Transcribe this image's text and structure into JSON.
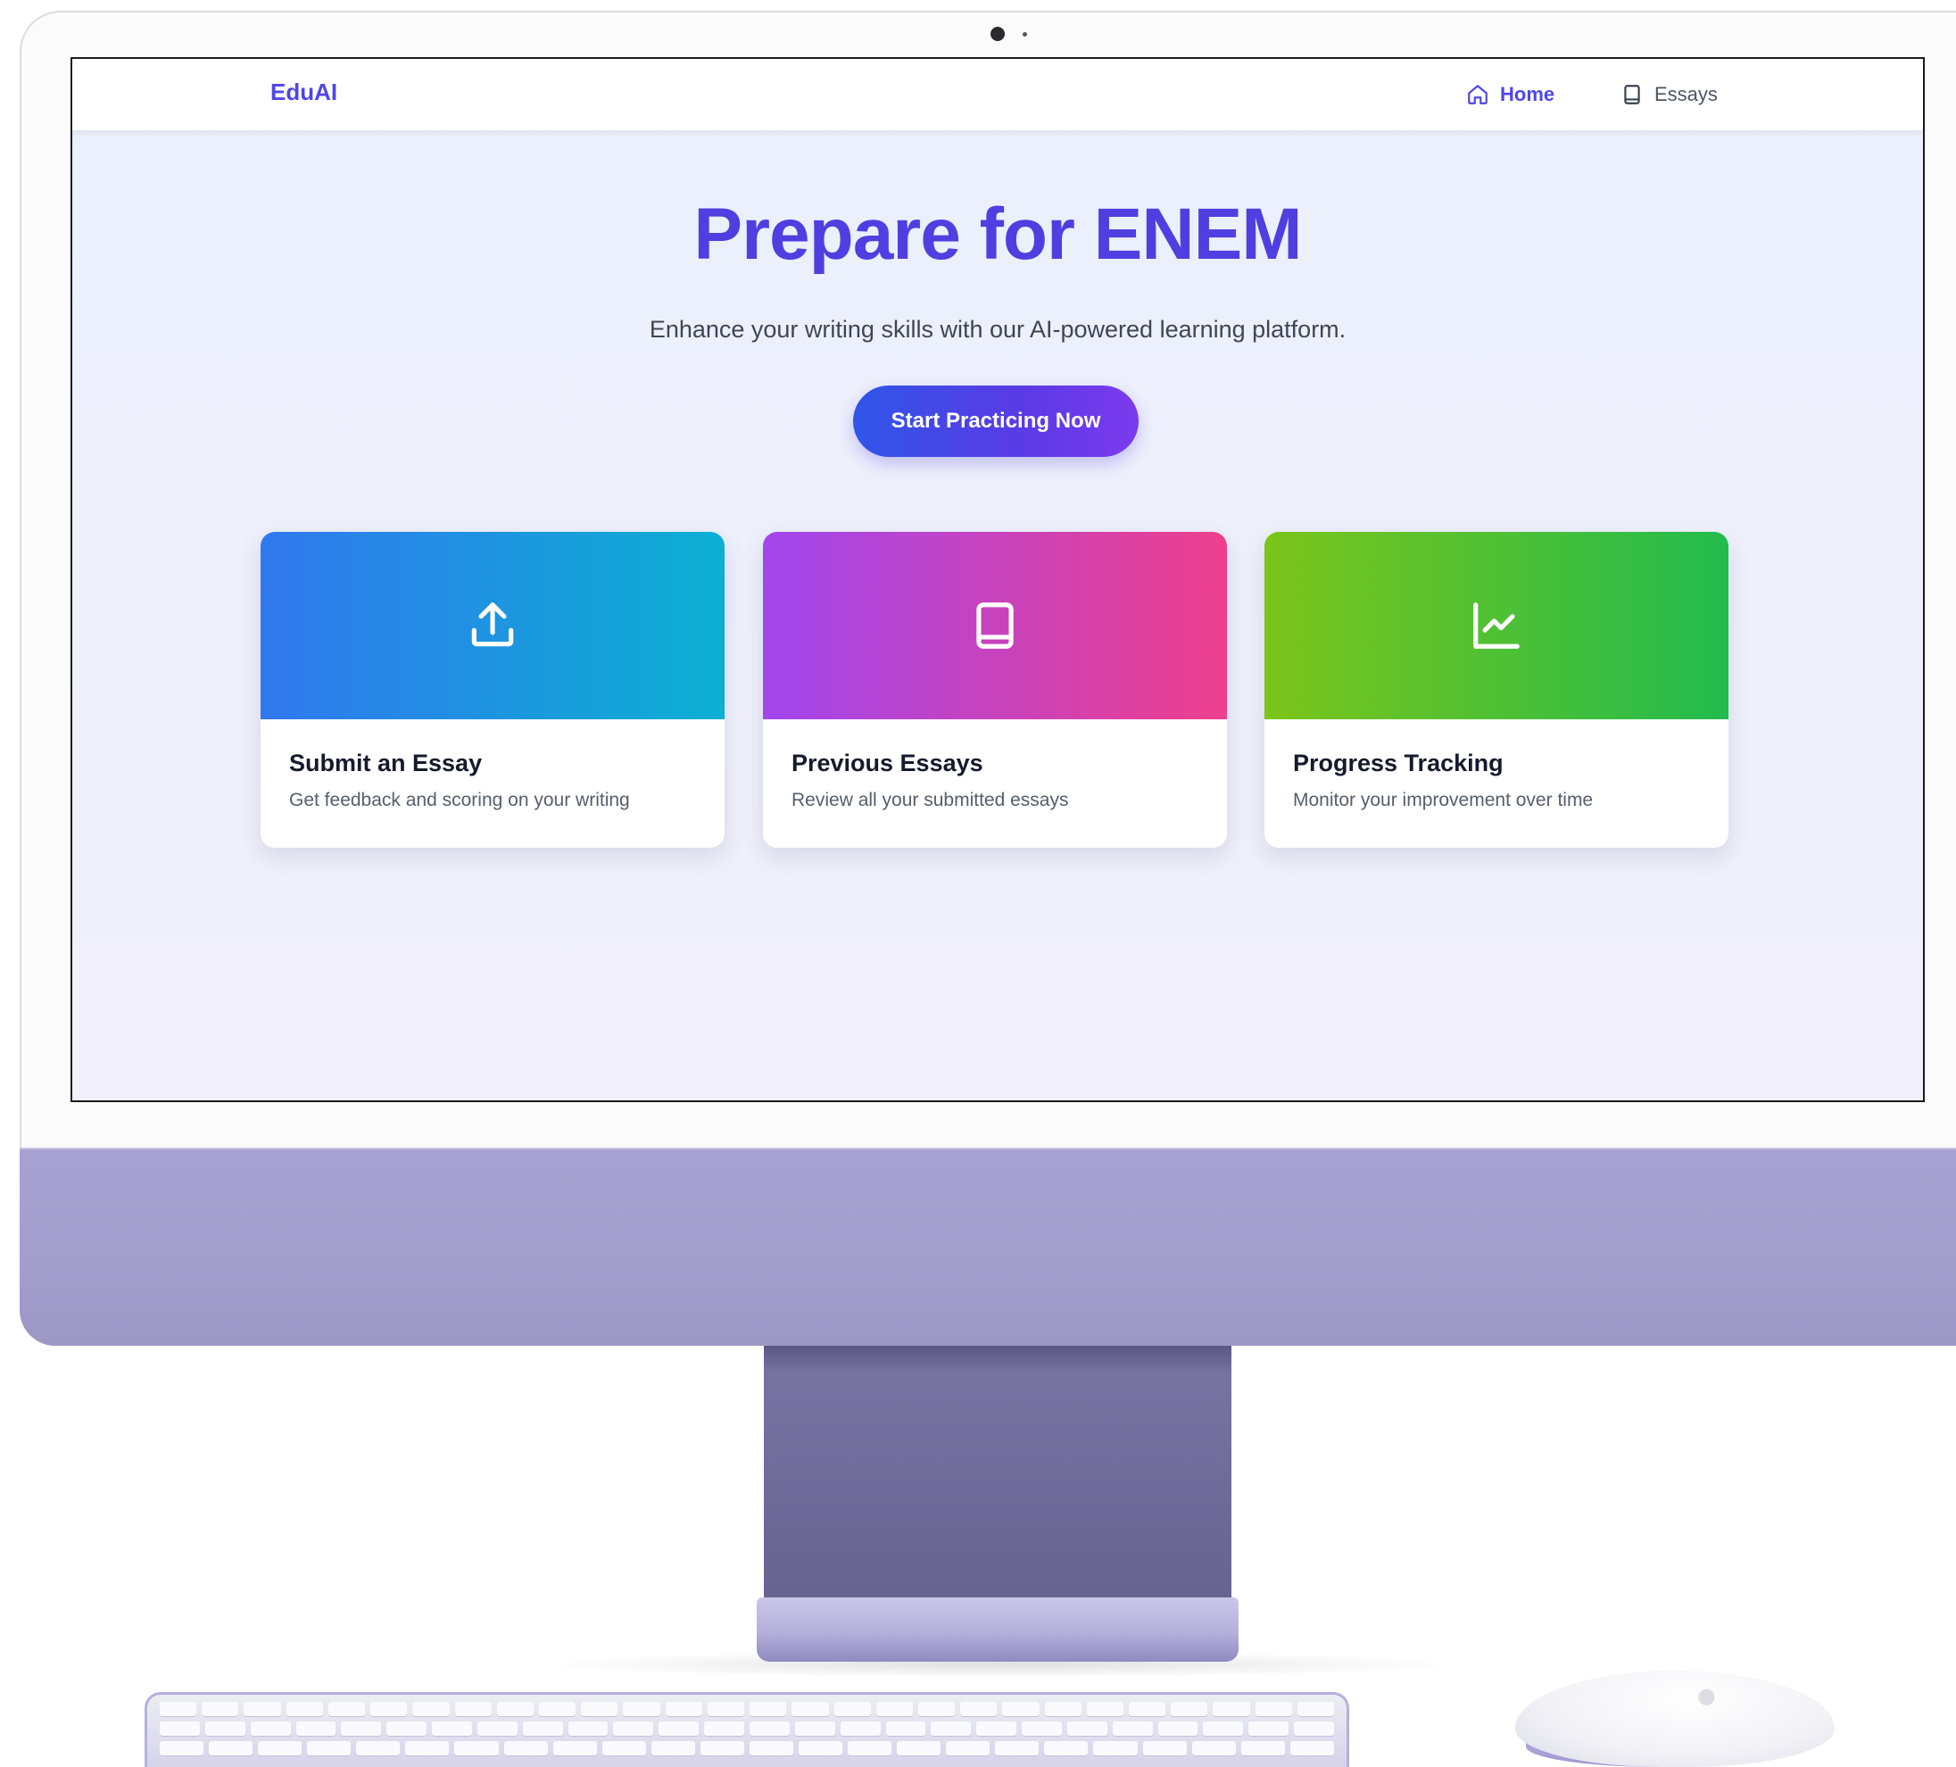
{
  "nav": {
    "brand": "EduAI",
    "links": [
      {
        "label": "Home",
        "icon": "home-icon",
        "active": true
      },
      {
        "label": "Essays",
        "icon": "book-icon",
        "active": false
      }
    ]
  },
  "hero": {
    "title": "Prepare for ENEM",
    "subtitle": "Enhance your writing skills with our AI-powered learning platform.",
    "cta_label": "Start Practicing Now"
  },
  "cards": [
    {
      "title": "Submit an Essay",
      "description": "Get feedback and scoring on your writing",
      "icon": "upload-icon",
      "gradient": [
        "#3178ee",
        "#0bb0d2"
      ]
    },
    {
      "title": "Previous Essays",
      "description": "Review all your submitted essays",
      "icon": "book-icon",
      "gradient": [
        "#a146ee",
        "#ee3f8c"
      ]
    },
    {
      "title": "Progress Tracking",
      "description": "Monitor your improvement over time",
      "icon": "line-chart-icon",
      "gradient": [
        "#7cc51a",
        "#22bb4e"
      ]
    }
  ],
  "colors": {
    "accent": "#4f46e5",
    "hero_title": "#4f3fe0",
    "monitor_chin": "#a8a2d2",
    "page_bg": "#eef0fb"
  }
}
